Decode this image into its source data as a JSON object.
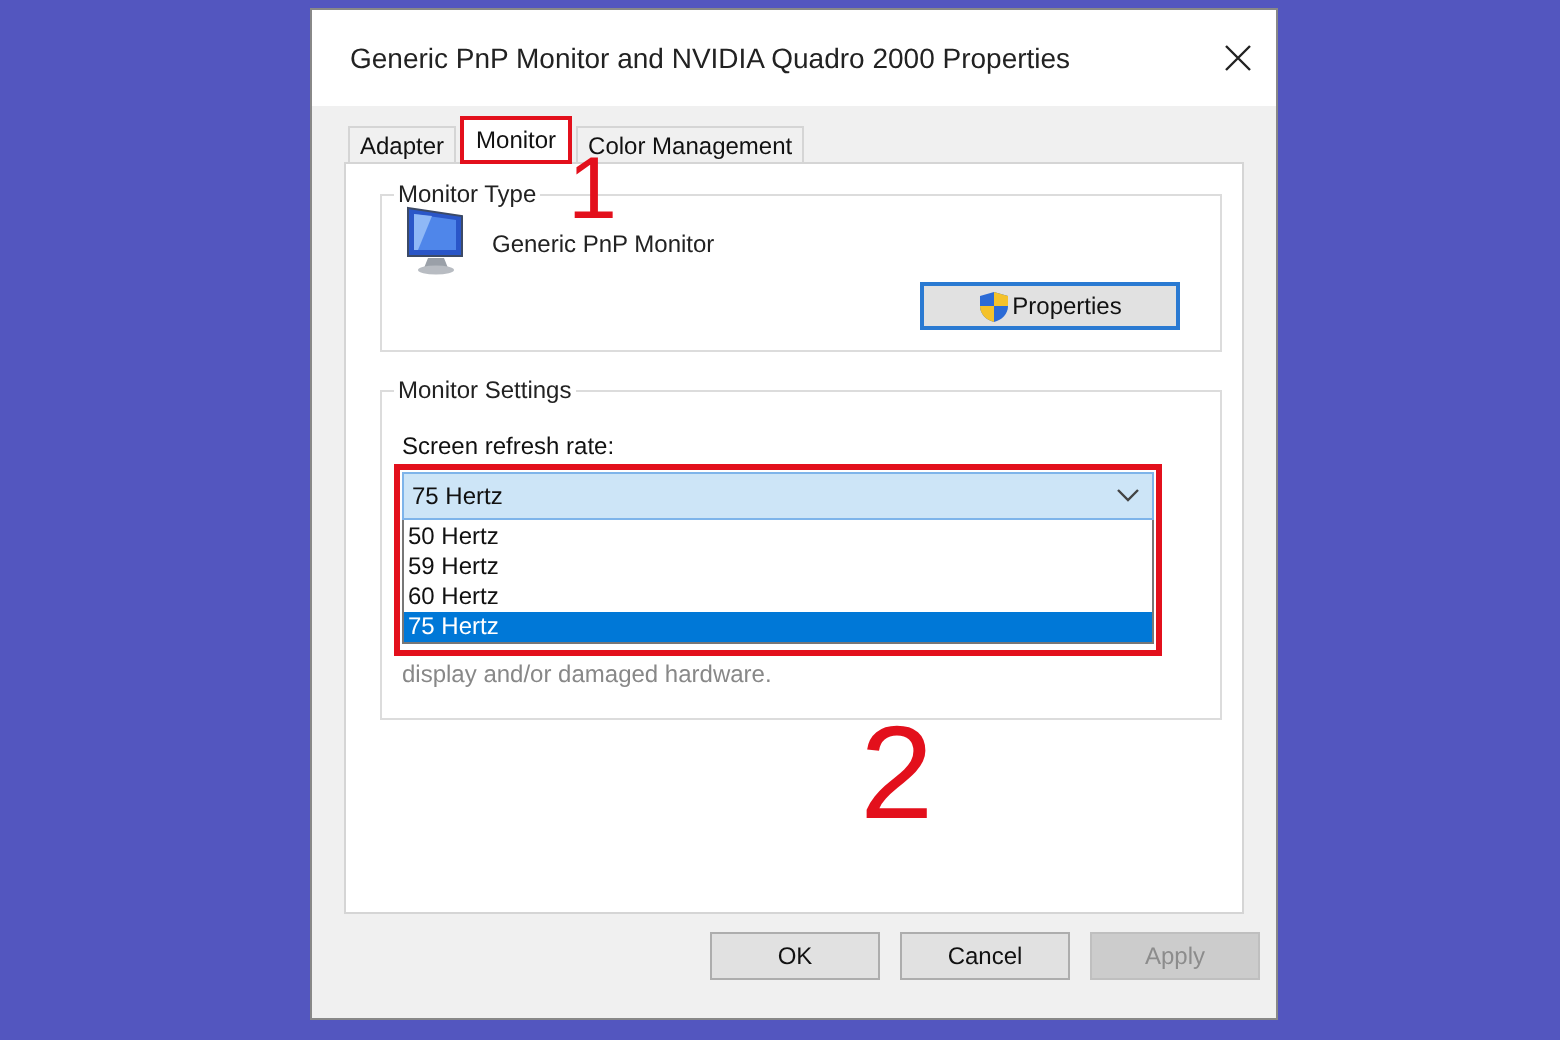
{
  "window": {
    "title": "Generic PnP Monitor and NVIDIA Quadro 2000 Properties"
  },
  "tabs": [
    {
      "label": "Adapter",
      "selected": false,
      "highlighted": false
    },
    {
      "label": "Monitor",
      "selected": true,
      "highlighted": true
    },
    {
      "label": "Color Management",
      "selected": false,
      "highlighted": false
    }
  ],
  "monitor_type": {
    "legend": "Monitor Type",
    "name": "Generic PnP Monitor",
    "button": "Properties"
  },
  "monitor_settings": {
    "legend": "Monitor Settings",
    "refresh_label": "Screen refresh rate:",
    "refresh_value": "75 Hertz",
    "expanded": true,
    "highlighted": true,
    "options": [
      {
        "label": "50 Hertz",
        "selected": false
      },
      {
        "label": "59 Hertz",
        "selected": false
      },
      {
        "label": "60 Hertz",
        "selected": false
      },
      {
        "label": "75 Hertz",
        "selected": true
      }
    ],
    "note": "display and/or damaged hardware."
  },
  "annotations": [
    {
      "label": "1"
    },
    {
      "label": "2"
    }
  ],
  "buttons": [
    {
      "label": "OK",
      "disabled": false
    },
    {
      "label": "Cancel",
      "disabled": false
    },
    {
      "label": "Apply",
      "disabled": true
    }
  ]
}
